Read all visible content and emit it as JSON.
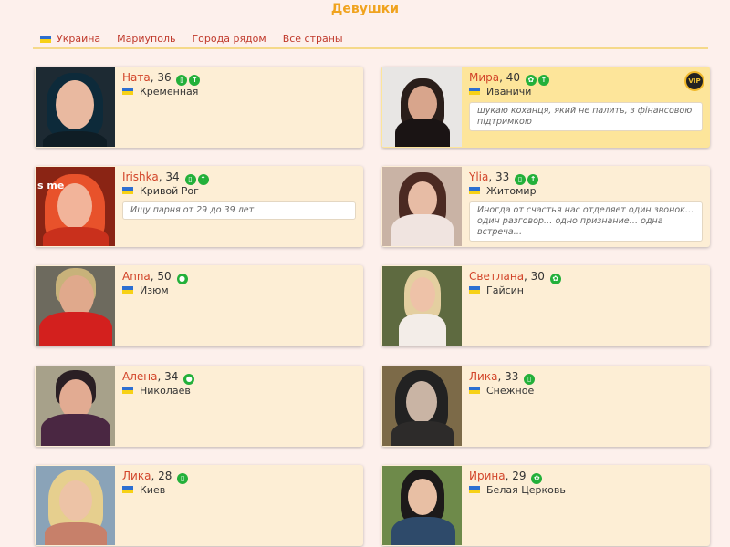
{
  "page": {
    "title": "Девушки"
  },
  "tabs": [
    {
      "label": "Украина",
      "has_flag": true
    },
    {
      "label": "Мариуполь"
    },
    {
      "label": "Города рядом"
    },
    {
      "label": "Все страны"
    }
  ],
  "colors": {
    "accent": "#f0a31e",
    "name": "#d2452a",
    "card": "#fdeed5",
    "vip_card": "#fde59a",
    "online": "#23b03a"
  },
  "profiles": [
    {
      "name": "Ната",
      "age": ", 36",
      "city": "Кременная",
      "badges": [
        "device-icon",
        "up-arrow-icon"
      ],
      "quote": ""
    },
    {
      "name": "Мира",
      "age": ", 40",
      "city": "Иваничи",
      "badges": [
        "gift-icon",
        "up-arrow-icon"
      ],
      "quote": "шукаю коханця, який не палить, з фінансовою підтримкою",
      "vip": "VIP"
    },
    {
      "name": "Irishka",
      "age": ", 34",
      "city": "Кривой Рог",
      "badges": [
        "device-icon",
        "up-arrow-icon"
      ],
      "quote": "Ищу парня от 29 до 39 лет",
      "photo_text": "s me"
    },
    {
      "name": "Ylia",
      "age": ", 33",
      "city": "Житомир",
      "badges": [
        "device-icon",
        "up-arrow-icon"
      ],
      "quote": "Иногда от счастья нас отделяет один звонок… один разговор… одно признание… одна встреча…"
    },
    {
      "name": "Anna",
      "age": ", 50",
      "city": "Изюм",
      "badges": [
        "online-dot-icon"
      ],
      "quote": ""
    },
    {
      "name": "Светлана",
      "age": ", 30",
      "city": "Гайсин",
      "badges": [
        "gift-icon"
      ],
      "quote": ""
    },
    {
      "name": "Алена",
      "age": ", 34",
      "city": "Николаев",
      "badges": [
        "online-dot-icon"
      ],
      "quote": ""
    },
    {
      "name": "Лика",
      "age": ", 33",
      "city": "Снежное",
      "badges": [
        "device-icon"
      ],
      "quote": ""
    },
    {
      "name": "Лика",
      "age": ", 28",
      "city": "Киев",
      "badges": [
        "device-icon"
      ],
      "quote": ""
    },
    {
      "name": "Ирина",
      "age": ", 29",
      "city": "Белая Церковь",
      "badges": [
        "gift-icon"
      ],
      "quote": ""
    }
  ]
}
